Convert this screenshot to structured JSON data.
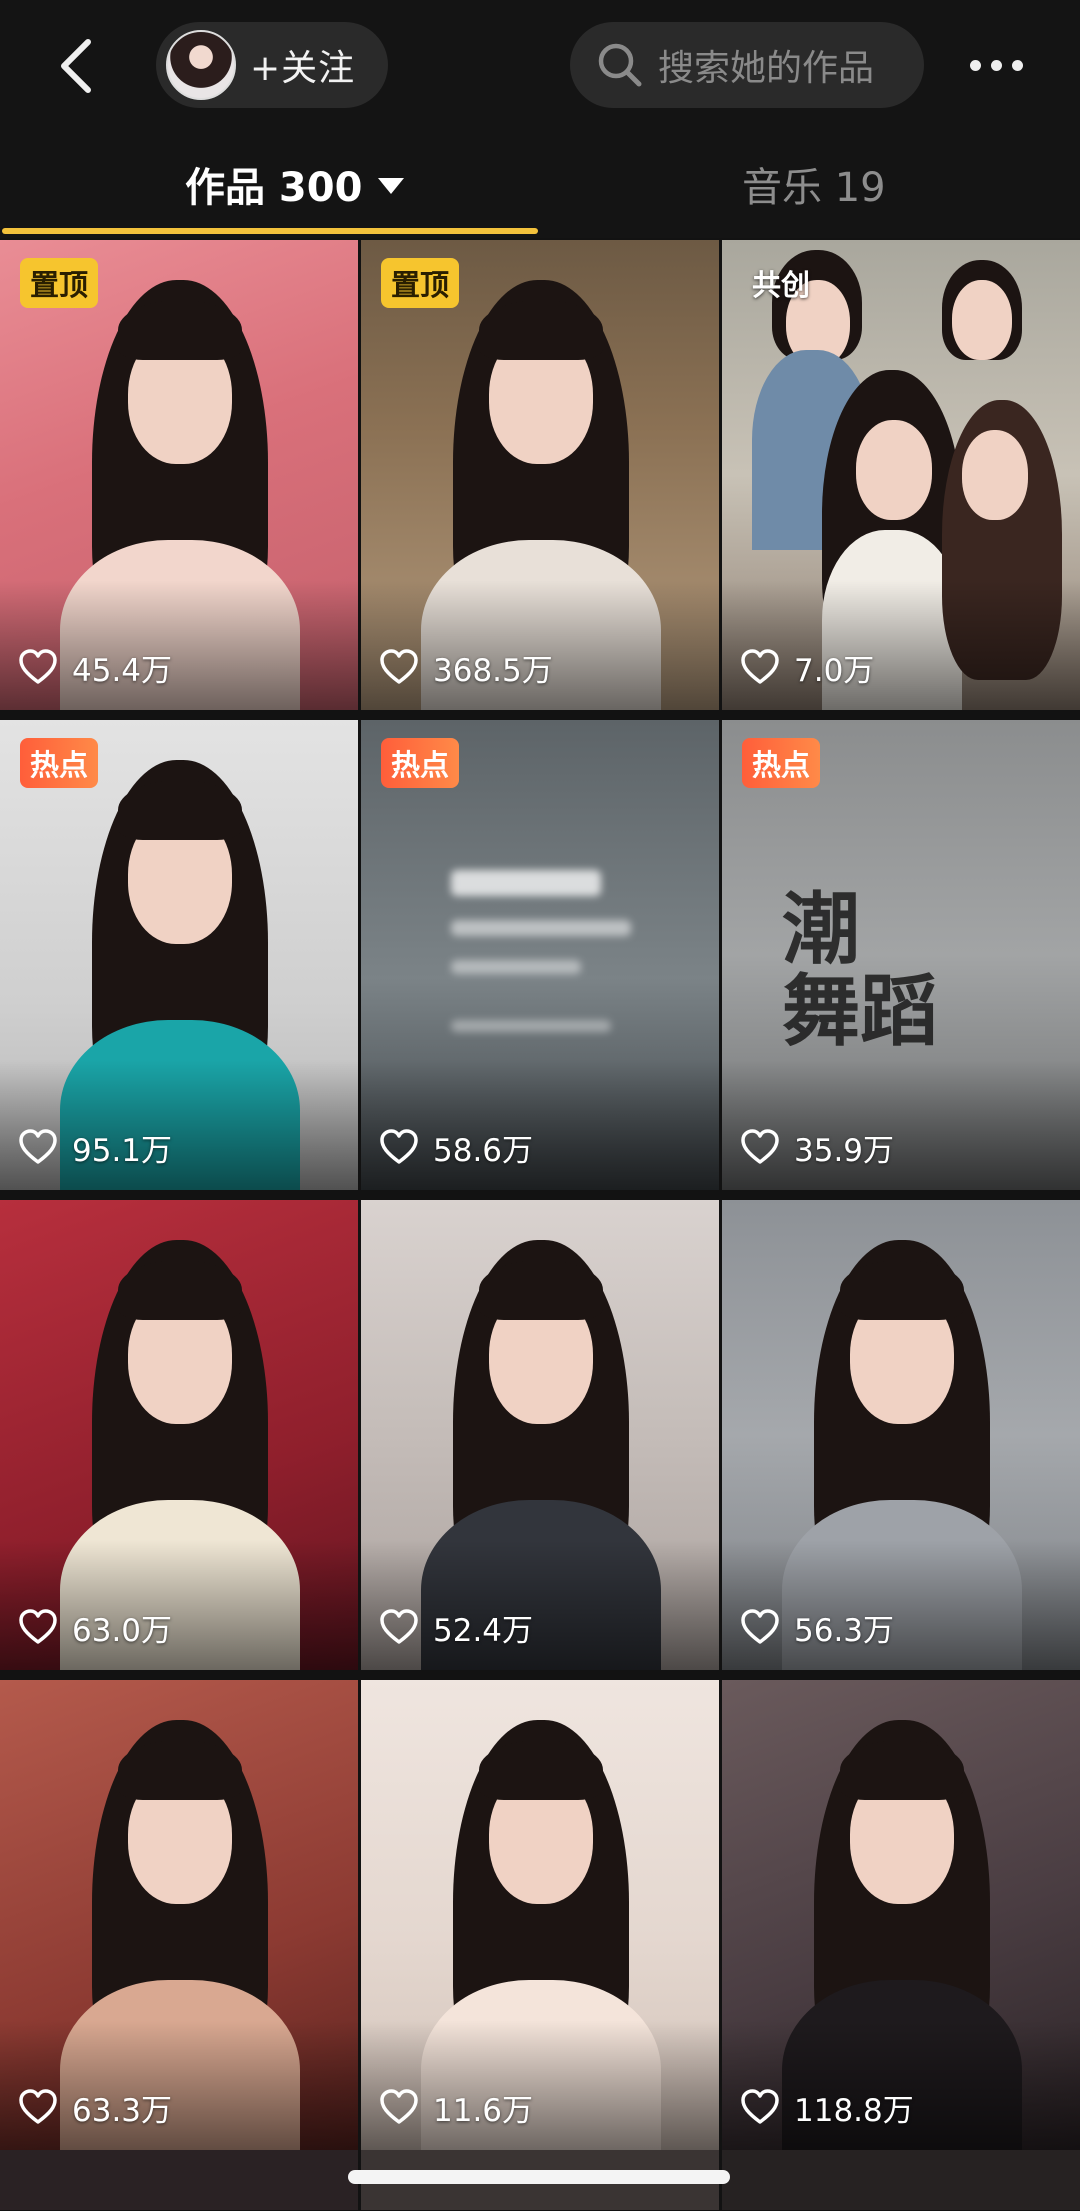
{
  "topbar": {
    "follow_label": "+关注",
    "search_placeholder": "搜索她的作品"
  },
  "tabs": {
    "works": {
      "label": "作品 300"
    },
    "music": {
      "label": "音乐 19"
    }
  },
  "colors": {
    "accent": "#f3c23c",
    "pin_badge": "#f6c52e",
    "hot_badge": "#ff5e3a",
    "background": "#121212"
  },
  "videos": [
    {
      "badge": "置顶",
      "badge_type": "pin",
      "likes": "45.4万",
      "scene": "pink"
    },
    {
      "badge": "置顶",
      "badge_type": "pin",
      "likes": "368.5万",
      "scene": "wood"
    },
    {
      "badge": "共创",
      "badge_type": "co",
      "likes": "7.0万",
      "scene": "group"
    },
    {
      "badge": "热点",
      "badge_type": "hot",
      "likes": "95.1万",
      "scene": "studio"
    },
    {
      "badge": "热点",
      "badge_type": "hot",
      "likes": "58.6万",
      "scene": "blur"
    },
    {
      "badge": "热点",
      "badge_type": "hot",
      "likes": "35.9万",
      "scene": "poster"
    },
    {
      "badge": "",
      "badge_type": "",
      "likes": "63.0万",
      "scene": "red"
    },
    {
      "badge": "",
      "badge_type": "",
      "likes": "52.4万",
      "scene": "light"
    },
    {
      "badge": "",
      "badge_type": "",
      "likes": "56.3万",
      "scene": "grey"
    },
    {
      "badge": "",
      "badge_type": "",
      "likes": "63.3万",
      "scene": "warm"
    },
    {
      "badge": "",
      "badge_type": "",
      "likes": "11.6万",
      "scene": "cream"
    },
    {
      "badge": "",
      "badge_type": "",
      "likes": "118.8万",
      "scene": "dusk"
    }
  ],
  "poster_text": "潮\n舞蹈"
}
